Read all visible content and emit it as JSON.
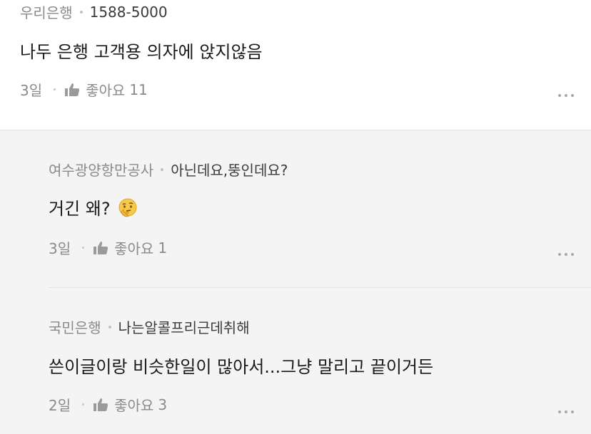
{
  "comments": [
    {
      "author": "우리은행",
      "subtitle": "1588-5000",
      "text": "나두 은행 고객용 의자에 앉지않음",
      "age": "3일",
      "like_label": "좋아요",
      "like_count": "11"
    }
  ],
  "replies": [
    {
      "author": "여수광양항만공사",
      "subtitle": "아닌데요,뚱인데요?",
      "text": "거긴 왜?",
      "emoji": "thinking-face",
      "age": "3일",
      "like_label": "좋아요",
      "like_count": "1"
    },
    {
      "author": "국민은행",
      "subtitle": "나는알콜프리근데취해",
      "text": "쓴이글이랑 비슷한일이 많아서...그냥 말리고 끝이거든",
      "age": "2일",
      "like_label": "좋아요",
      "like_count": "3"
    }
  ],
  "icons": {
    "like": "thumbs-up-icon",
    "more": "more-options-icon"
  },
  "colors": {
    "meta_gray": "#8a8a8a",
    "reply_background": "#f4f4f4"
  }
}
